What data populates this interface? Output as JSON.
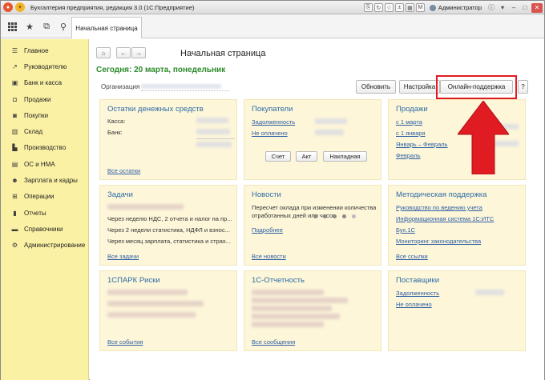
{
  "window": {
    "title": "Бухгалтерия предприятия, редакция 3.0  (1С:Предприятие)",
    "user": "Администратор"
  },
  "tabs": [
    {
      "label": "Начальная страница"
    }
  ],
  "sidebar": {
    "items": [
      {
        "label": "Главное",
        "icon": "list-icon"
      },
      {
        "label": "Руководителю",
        "icon": "chart-line-icon"
      },
      {
        "label": "Банк и касса",
        "icon": "bank-icon"
      },
      {
        "label": "Продажи",
        "icon": "bag-icon"
      },
      {
        "label": "Покупки",
        "icon": "cart-icon"
      },
      {
        "label": "Склад",
        "icon": "warehouse-icon"
      },
      {
        "label": "Производство",
        "icon": "factory-icon"
      },
      {
        "label": "ОС и НМА",
        "icon": "assets-icon"
      },
      {
        "label": "Зарплата и кадры",
        "icon": "people-icon"
      },
      {
        "label": "Операции",
        "icon": "operations-icon"
      },
      {
        "label": "Отчеты",
        "icon": "reports-icon"
      },
      {
        "label": "Справочники",
        "icon": "book-icon"
      },
      {
        "label": "Администрирование",
        "icon": "gear-icon"
      }
    ]
  },
  "page": {
    "title": "Начальная страница",
    "today": "Сегодня: 20 марта, понедельник",
    "org_label": "Организация",
    "buttons": {
      "refresh": "Обновить",
      "settings": "Настройка",
      "support": "Онлайн-поддержка",
      "help": "?"
    }
  },
  "panels": {
    "cash": {
      "title": "Остатки денежных средств",
      "kassa": "Касса:",
      "bank": "Банк:",
      "link": "Все остатки"
    },
    "buyers": {
      "title": "Покупатели",
      "debt": "Задолженность",
      "unpaid": "Не оплачено",
      "btn_invoice": "Счет",
      "btn_act": "Акт",
      "btn_waybill": "Накладная"
    },
    "sales": {
      "title": "Продажи",
      "since_march": "с 1 марта",
      "since_jan": "с 1 января",
      "jan_feb": "Январь – Февраль",
      "feb": "Февраль"
    },
    "tasks": {
      "title": "Задачи",
      "items": [
        "Через неделю НДС, 2 отчета и налог на пр...",
        "Через 2 недели статистика, НДФЛ и взнос...",
        "Через месяц зарплата, статистика и страх..."
      ],
      "link": "Все задачи"
    },
    "news": {
      "title": "Новости",
      "text1": "Пересчет оклада при изменении количества",
      "text2": "отработанных дней или часов",
      "more": "Подробнее",
      "link": "Все новости"
    },
    "method": {
      "title": "Методическая поддержка",
      "links": [
        "Руководство по ведению учета",
        "Информационная система 1С:ИТС",
        "Бух.1С",
        "Мониторинг законодательства"
      ],
      "all": "Все ссылки"
    },
    "spark": {
      "title": "1СПАРК Риски",
      "link": "Все события"
    },
    "report": {
      "title": "1С-Отчетность",
      "link": "Все сообщения"
    },
    "suppliers": {
      "title": "Поставщики",
      "debt": "Задолженность",
      "unpaid": "Не оплачено"
    }
  },
  "colors": {
    "sidebar_bg": "#fbf1a4",
    "panel_bg": "#fdf6d9",
    "title_blue": "#2d6ca5",
    "today_green": "#2b8a2b",
    "highlight_red": "#e01b22"
  }
}
